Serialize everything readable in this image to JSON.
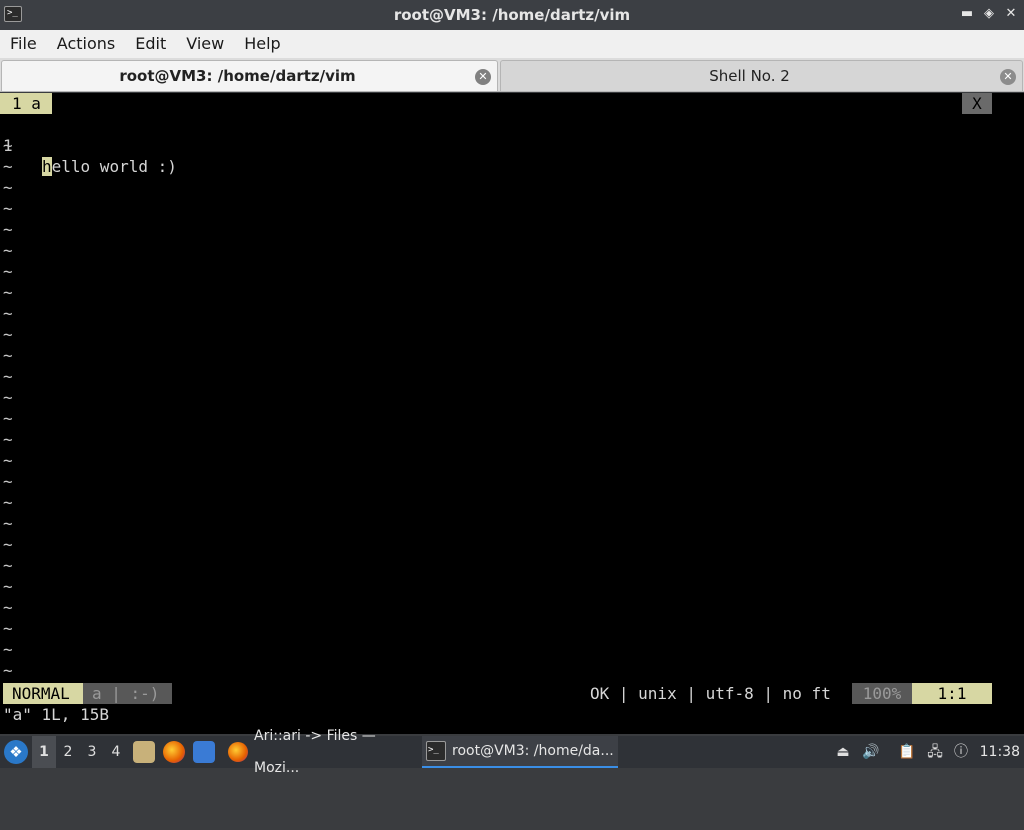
{
  "window": {
    "title": "root@VM3: /home/dartz/vim",
    "app_icon_glyph": ">_",
    "controls": {
      "minimize": "▬",
      "restore": "◈",
      "close": "✕"
    }
  },
  "menu": [
    "File",
    "Actions",
    "Edit",
    "View",
    "Help"
  ],
  "tabs": [
    {
      "label": "root@VM3: /home/dartz/vim",
      "active": true,
      "close": "✕"
    },
    {
      "label": "Shell No. 2",
      "active": false,
      "close": "✕"
    }
  ],
  "vim": {
    "buffer_tab": "1 a",
    "buffer_close": "X",
    "lines": [
      {
        "number": "1",
        "cursor_char": "h",
        "rest": "ello world :)"
      }
    ],
    "tilde": "~",
    "tilde_count": 26,
    "status": {
      "mode": "NORMAL",
      "file": "a | :-)",
      "right": "OK | unix | utf-8 | no ft",
      "percent": "100%",
      "position": "1:1"
    },
    "message": "\"a\" 1L, 15B"
  },
  "taskbar": {
    "workspaces": [
      "1",
      "2",
      "3",
      "4"
    ],
    "active_workspace": "1",
    "tasks": [
      {
        "label": "Ari::ari -> Files — Mozi...",
        "icon": "firefox-icon"
      },
      {
        "label": "root@VM3: /home/da...",
        "icon": "terminal-icon",
        "active": true
      }
    ],
    "clock": "11:38"
  },
  "colors": {
    "vim_highlight": "#d7d7a3",
    "vim_dim": "#585858",
    "terminal_bg": "#000000",
    "taskbar_bg": "#2f3237",
    "titlebar_bg": "#3c3f44"
  }
}
